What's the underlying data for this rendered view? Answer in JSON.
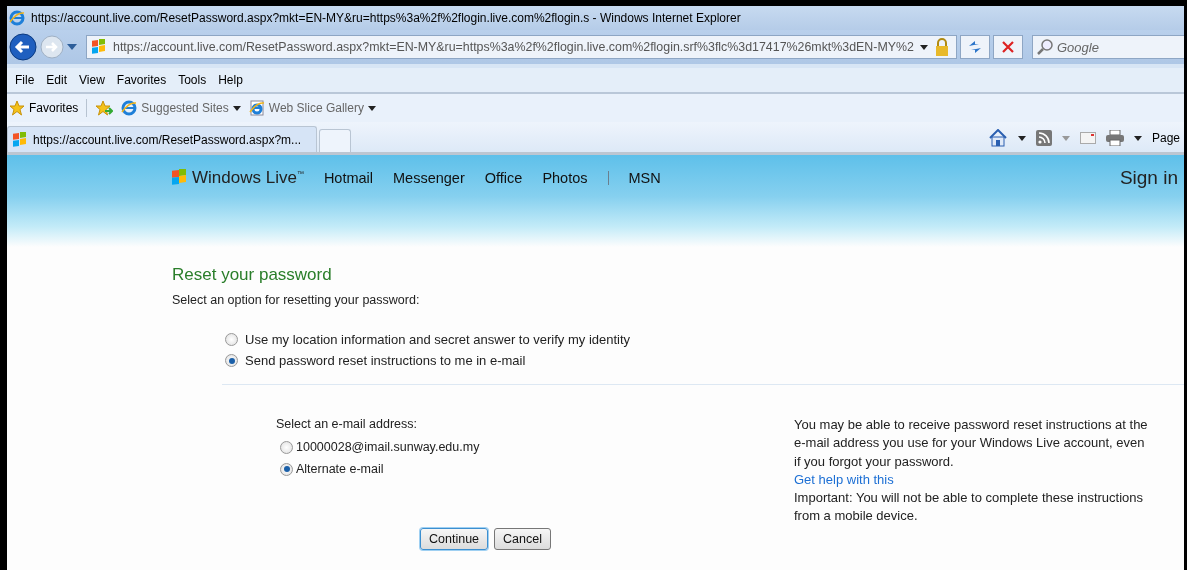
{
  "window": {
    "title": "https://account.live.com/ResetPassword.aspx?mkt=EN-MY&ru=https%3a%2f%2flogin.live.com%2flogin.s - Windows Internet Explorer"
  },
  "address_bar": {
    "url": "https://account.live.com/ResetPassword.aspx?mkt=EN-MY&ru=https%3a%2f%2flogin.live.com%2flogin.srf%3flc%3d17417%26mkt%3dEN-MY%2"
  },
  "search": {
    "placeholder": "Google"
  },
  "menu": [
    "File",
    "Edit",
    "View",
    "Favorites",
    "Tools",
    "Help"
  ],
  "favorites_bar": {
    "favorites": "Favorites",
    "items": [
      "Suggested Sites",
      "Web Slice Gallery"
    ]
  },
  "tabs": [
    {
      "label": "https://account.live.com/ResetPassword.aspx?m...",
      "selected": true
    }
  ],
  "command_bar": {
    "page_menu": "Page"
  },
  "site_header": {
    "brand": "Windows Live$^{™}$",
    "nav": [
      {
        "kind": "link",
        "label": "Hotmail"
      },
      {
        "kind": "link",
        "label": "Messenger"
      },
      {
        "kind": "link",
        "label": "Office"
      },
      {
        "kind": "link",
        "label": "Photos"
      },
      {
        "kind": "separator"
      },
      {
        "kind": "link",
        "label": "MSN"
      }
    ],
    "sign_in": "Sign in"
  },
  "reset": {
    "heading": "Reset your password",
    "prompt": "Select an option for resetting your password:",
    "options": [
      {
        "label": "Use my location information and secret answer to verify my identity",
        "selected": false
      },
      {
        "label": "Send password reset instructions to me in e-mail",
        "selected": true
      }
    ],
    "email_label": "Select an e-mail address:",
    "emails": [
      {
        "label": "10000028@imail.sunway.edu.my",
        "selected": false
      },
      {
        "label": "Alternate e-mail",
        "selected": true
      }
    ],
    "buttons": [
      {
        "label": "Continue",
        "focused": true
      },
      {
        "label": "Cancel",
        "focused": false
      }
    ]
  },
  "info": {
    "text": "You may be able to receive password reset instructions at the e-mail address you use for your Windows Live account, even if you forgot your password.",
    "link": "Get help with this",
    "note": "Important: You will not be able to complete these instructions from a mobile device."
  }
}
